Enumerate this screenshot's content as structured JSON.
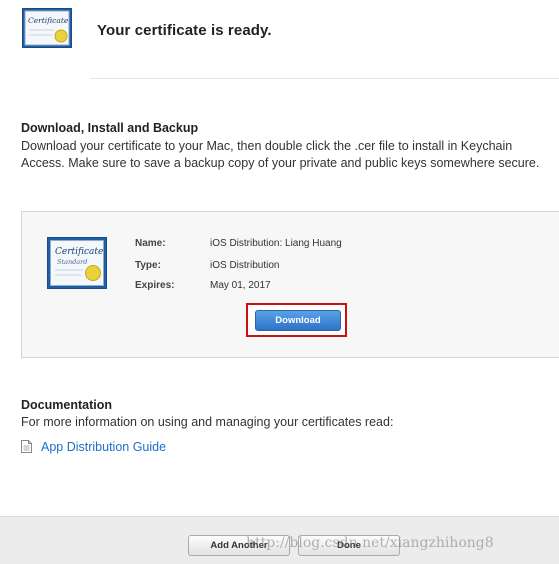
{
  "header": {
    "title": "Your certificate is ready.",
    "icon": "certificate-icon",
    "icon_text": "Certificate"
  },
  "instructions": {
    "title": "Download, Install and Backup",
    "body": "Download your certificate to your Mac, then double click the .cer file to install in Keychain Access. Make sure to save a backup copy of your private and public keys somewhere secure."
  },
  "certificate": {
    "icon_text": "Certificate",
    "icon_subtext": "Standard",
    "fields": [
      {
        "label": "Name:",
        "value": "iOS Distribution: Liang Huang"
      },
      {
        "label": "Type:",
        "value": "iOS Distribution"
      },
      {
        "label": "Expires:",
        "value": "May 01, 2017"
      }
    ],
    "download_label": "Download",
    "highlight_color": "#cc1111"
  },
  "documentation": {
    "title": "Documentation",
    "body": "For more information on using and managing your certificates read:",
    "link_label": "App Distribution Guide",
    "link_icon": "document-icon",
    "link_color": "#1f6fc5"
  },
  "footer": {
    "add_another_label": "Add Another",
    "done_label": "Done",
    "watermark": "http://blog.csdn.net/xiangzhihong8"
  },
  "colors": {
    "primary_button": "#2e72c6",
    "link": "#1f6fc5"
  }
}
